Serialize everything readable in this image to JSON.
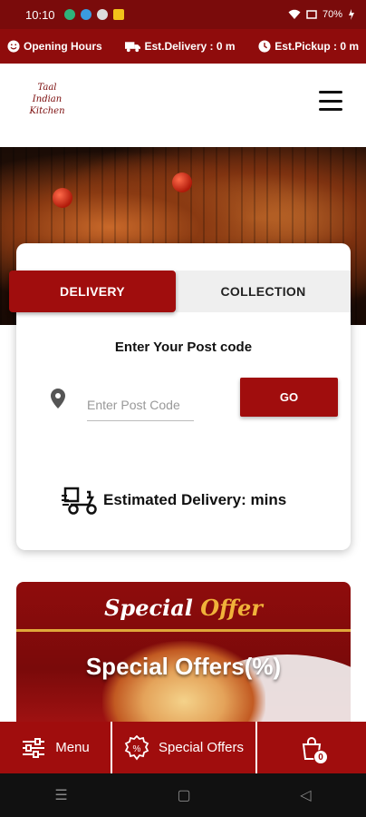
{
  "status_bar": {
    "time": "10:10",
    "battery": "70%"
  },
  "info_bar": {
    "opening_hours": "Opening Hours",
    "est_delivery": "Est.Delivery : 0 m",
    "est_pickup": "Est.Pickup : 0 m"
  },
  "header": {
    "logo_lines": [
      "Taal",
      "Indian",
      "Kitchen"
    ]
  },
  "order_card": {
    "tabs": [
      {
        "label": "DELIVERY",
        "active": true
      },
      {
        "label": "COLLECTION",
        "active": false
      }
    ],
    "post_code_label": "Enter Your Post code",
    "post_code_placeholder": "Enter Post Code",
    "go_label": "GO",
    "estimated_delivery": "Estimated Delivery: mins"
  },
  "special_offer_banner": {
    "script_word1": "Special",
    "script_word2": "Offer",
    "title": "Special Offers(%)"
  },
  "bottom_nav": {
    "menu_label": "Menu",
    "offers_label": "Special Offers",
    "cart_count": "0"
  },
  "colors": {
    "brand": "#a00d0d",
    "brand_dark": "#7a0b0b",
    "accent": "#f0b23a"
  }
}
